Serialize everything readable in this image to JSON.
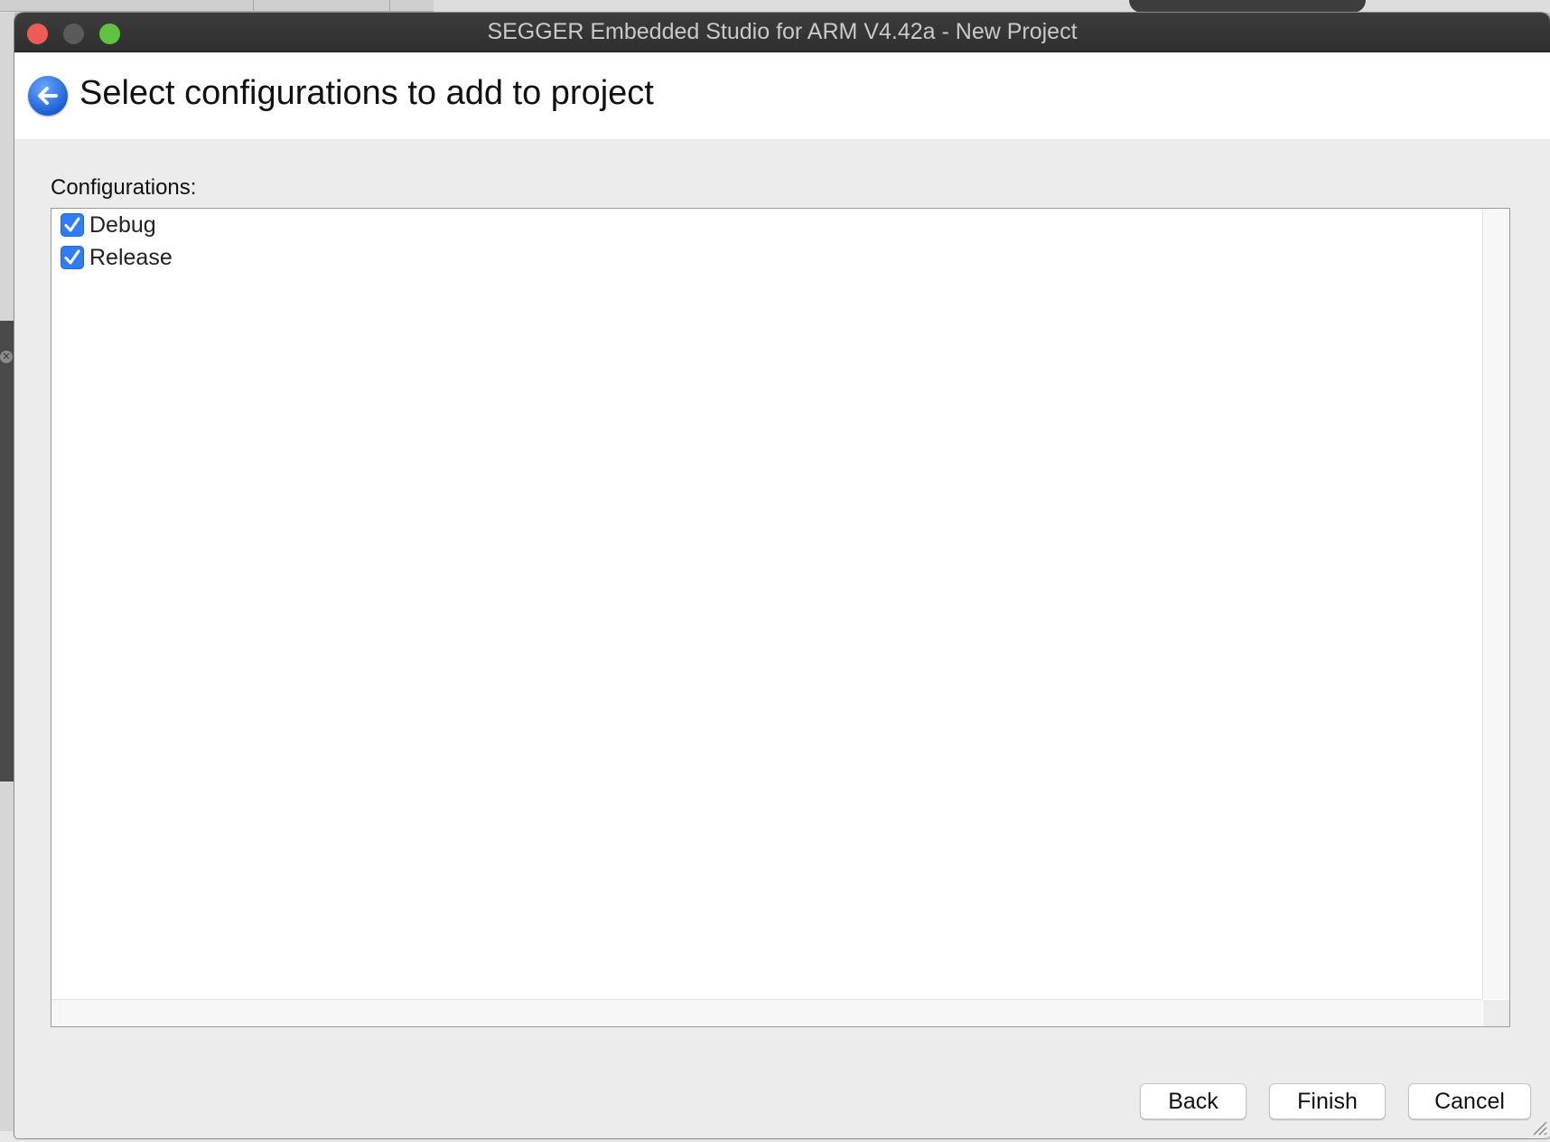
{
  "window": {
    "title": "SEGGER Embedded Studio for ARM V4.42a - New Project"
  },
  "header": {
    "title": "Select configurations to add to project",
    "back_icon": "back-arrow-icon"
  },
  "configurations": {
    "label": "Configurations:",
    "items": [
      {
        "label": "Debug",
        "checked": true
      },
      {
        "label": "Release",
        "checked": true
      }
    ]
  },
  "buttons": {
    "back": "Back",
    "finish": "Finish",
    "cancel": "Cancel"
  },
  "colors": {
    "accent": "#2f7cf6",
    "close": "#ee5c55",
    "zoom": "#5fc240"
  }
}
